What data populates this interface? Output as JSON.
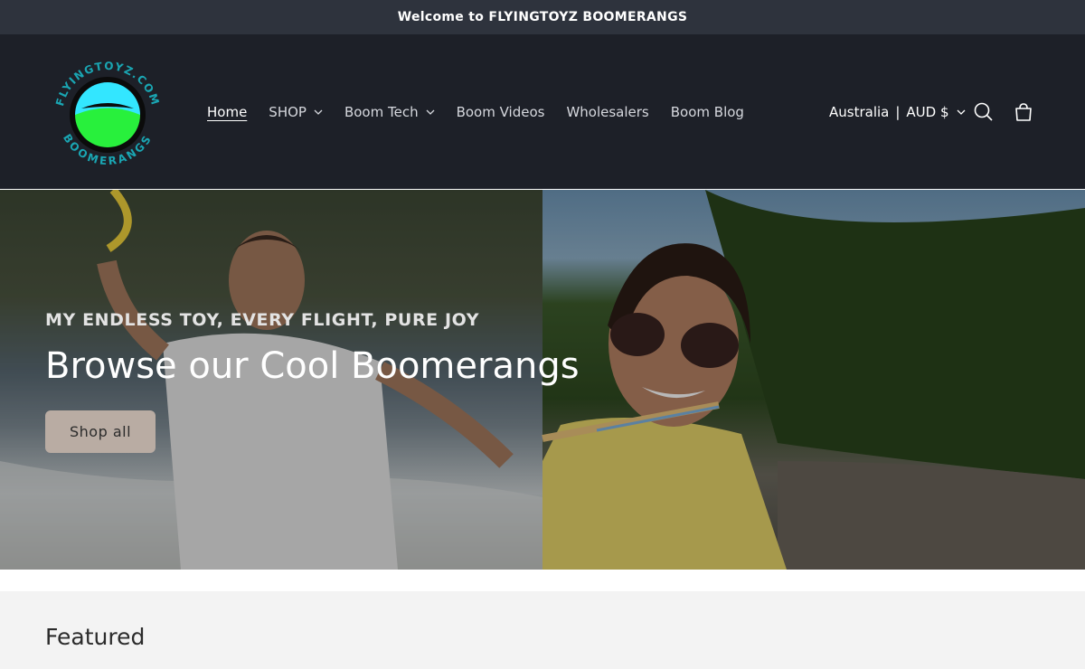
{
  "announcement": {
    "text": "Welcome to FLYINGTOYZ BOOMERANGS"
  },
  "logo": {
    "top_text": "FLYINGTOYZ.COM",
    "bottom_text": "BOOMERANGS"
  },
  "nav": {
    "items": [
      {
        "label": "Home",
        "active": true,
        "dropdown": false
      },
      {
        "label": "SHOP",
        "active": false,
        "dropdown": true
      },
      {
        "label": "Boom Tech",
        "active": false,
        "dropdown": true
      },
      {
        "label": "Boom Videos",
        "active": false,
        "dropdown": false
      },
      {
        "label": "Wholesalers",
        "active": false,
        "dropdown": false
      },
      {
        "label": "Boom Blog",
        "active": false,
        "dropdown": false
      }
    ]
  },
  "locale": {
    "country": "Australia",
    "separator": "|",
    "currency": "AUD $"
  },
  "icons": {
    "search": "search-icon",
    "cart": "cart-icon",
    "chevron": "chevron-down-icon"
  },
  "hero": {
    "subtitle": "MY ENDLESS TOY, EVERY FLIGHT, PURE JOY",
    "title": "Browse our Cool Boomerangs",
    "button_label": "Shop all"
  },
  "featured": {
    "heading": "Featured"
  },
  "colors": {
    "announce_bg": "#2e333d",
    "header_bg": "#1d2028",
    "button_bg": "#b9aca3",
    "logo_cyan": "#33e6ff",
    "logo_green": "#28f03c"
  }
}
